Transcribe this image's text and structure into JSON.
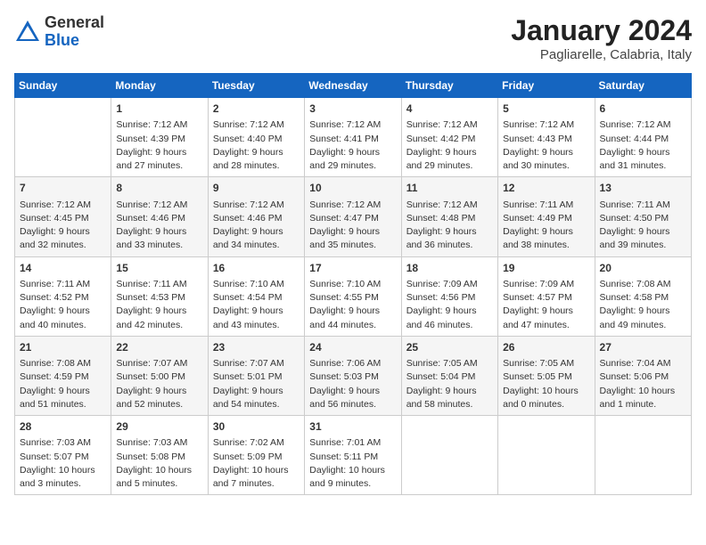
{
  "logo": {
    "general": "General",
    "blue": "Blue"
  },
  "header": {
    "month_title": "January 2024",
    "location": "Pagliarelle, Calabria, Italy"
  },
  "days_of_week": [
    "Sunday",
    "Monday",
    "Tuesday",
    "Wednesday",
    "Thursday",
    "Friday",
    "Saturday"
  ],
  "weeks": [
    [
      {
        "day": null,
        "details": null
      },
      {
        "day": "1",
        "details": "Sunrise: 7:12 AM\nSunset: 4:39 PM\nDaylight: 9 hours\nand 27 minutes."
      },
      {
        "day": "2",
        "details": "Sunrise: 7:12 AM\nSunset: 4:40 PM\nDaylight: 9 hours\nand 28 minutes."
      },
      {
        "day": "3",
        "details": "Sunrise: 7:12 AM\nSunset: 4:41 PM\nDaylight: 9 hours\nand 29 minutes."
      },
      {
        "day": "4",
        "details": "Sunrise: 7:12 AM\nSunset: 4:42 PM\nDaylight: 9 hours\nand 29 minutes."
      },
      {
        "day": "5",
        "details": "Sunrise: 7:12 AM\nSunset: 4:43 PM\nDaylight: 9 hours\nand 30 minutes."
      },
      {
        "day": "6",
        "details": "Sunrise: 7:12 AM\nSunset: 4:44 PM\nDaylight: 9 hours\nand 31 minutes."
      }
    ],
    [
      {
        "day": "7",
        "details": "Sunrise: 7:12 AM\nSunset: 4:45 PM\nDaylight: 9 hours\nand 32 minutes."
      },
      {
        "day": "8",
        "details": "Sunrise: 7:12 AM\nSunset: 4:46 PM\nDaylight: 9 hours\nand 33 minutes."
      },
      {
        "day": "9",
        "details": "Sunrise: 7:12 AM\nSunset: 4:46 PM\nDaylight: 9 hours\nand 34 minutes."
      },
      {
        "day": "10",
        "details": "Sunrise: 7:12 AM\nSunset: 4:47 PM\nDaylight: 9 hours\nand 35 minutes."
      },
      {
        "day": "11",
        "details": "Sunrise: 7:12 AM\nSunset: 4:48 PM\nDaylight: 9 hours\nand 36 minutes."
      },
      {
        "day": "12",
        "details": "Sunrise: 7:11 AM\nSunset: 4:49 PM\nDaylight: 9 hours\nand 38 minutes."
      },
      {
        "day": "13",
        "details": "Sunrise: 7:11 AM\nSunset: 4:50 PM\nDaylight: 9 hours\nand 39 minutes."
      }
    ],
    [
      {
        "day": "14",
        "details": "Sunrise: 7:11 AM\nSunset: 4:52 PM\nDaylight: 9 hours\nand 40 minutes."
      },
      {
        "day": "15",
        "details": "Sunrise: 7:11 AM\nSunset: 4:53 PM\nDaylight: 9 hours\nand 42 minutes."
      },
      {
        "day": "16",
        "details": "Sunrise: 7:10 AM\nSunset: 4:54 PM\nDaylight: 9 hours\nand 43 minutes."
      },
      {
        "day": "17",
        "details": "Sunrise: 7:10 AM\nSunset: 4:55 PM\nDaylight: 9 hours\nand 44 minutes."
      },
      {
        "day": "18",
        "details": "Sunrise: 7:09 AM\nSunset: 4:56 PM\nDaylight: 9 hours\nand 46 minutes."
      },
      {
        "day": "19",
        "details": "Sunrise: 7:09 AM\nSunset: 4:57 PM\nDaylight: 9 hours\nand 47 minutes."
      },
      {
        "day": "20",
        "details": "Sunrise: 7:08 AM\nSunset: 4:58 PM\nDaylight: 9 hours\nand 49 minutes."
      }
    ],
    [
      {
        "day": "21",
        "details": "Sunrise: 7:08 AM\nSunset: 4:59 PM\nDaylight: 9 hours\nand 51 minutes."
      },
      {
        "day": "22",
        "details": "Sunrise: 7:07 AM\nSunset: 5:00 PM\nDaylight: 9 hours\nand 52 minutes."
      },
      {
        "day": "23",
        "details": "Sunrise: 7:07 AM\nSunset: 5:01 PM\nDaylight: 9 hours\nand 54 minutes."
      },
      {
        "day": "24",
        "details": "Sunrise: 7:06 AM\nSunset: 5:03 PM\nDaylight: 9 hours\nand 56 minutes."
      },
      {
        "day": "25",
        "details": "Sunrise: 7:05 AM\nSunset: 5:04 PM\nDaylight: 9 hours\nand 58 minutes."
      },
      {
        "day": "26",
        "details": "Sunrise: 7:05 AM\nSunset: 5:05 PM\nDaylight: 10 hours\nand 0 minutes."
      },
      {
        "day": "27",
        "details": "Sunrise: 7:04 AM\nSunset: 5:06 PM\nDaylight: 10 hours\nand 1 minute."
      }
    ],
    [
      {
        "day": "28",
        "details": "Sunrise: 7:03 AM\nSunset: 5:07 PM\nDaylight: 10 hours\nand 3 minutes."
      },
      {
        "day": "29",
        "details": "Sunrise: 7:03 AM\nSunset: 5:08 PM\nDaylight: 10 hours\nand 5 minutes."
      },
      {
        "day": "30",
        "details": "Sunrise: 7:02 AM\nSunset: 5:09 PM\nDaylight: 10 hours\nand 7 minutes."
      },
      {
        "day": "31",
        "details": "Sunrise: 7:01 AM\nSunset: 5:11 PM\nDaylight: 10 hours\nand 9 minutes."
      },
      {
        "day": null,
        "details": null
      },
      {
        "day": null,
        "details": null
      },
      {
        "day": null,
        "details": null
      }
    ]
  ]
}
